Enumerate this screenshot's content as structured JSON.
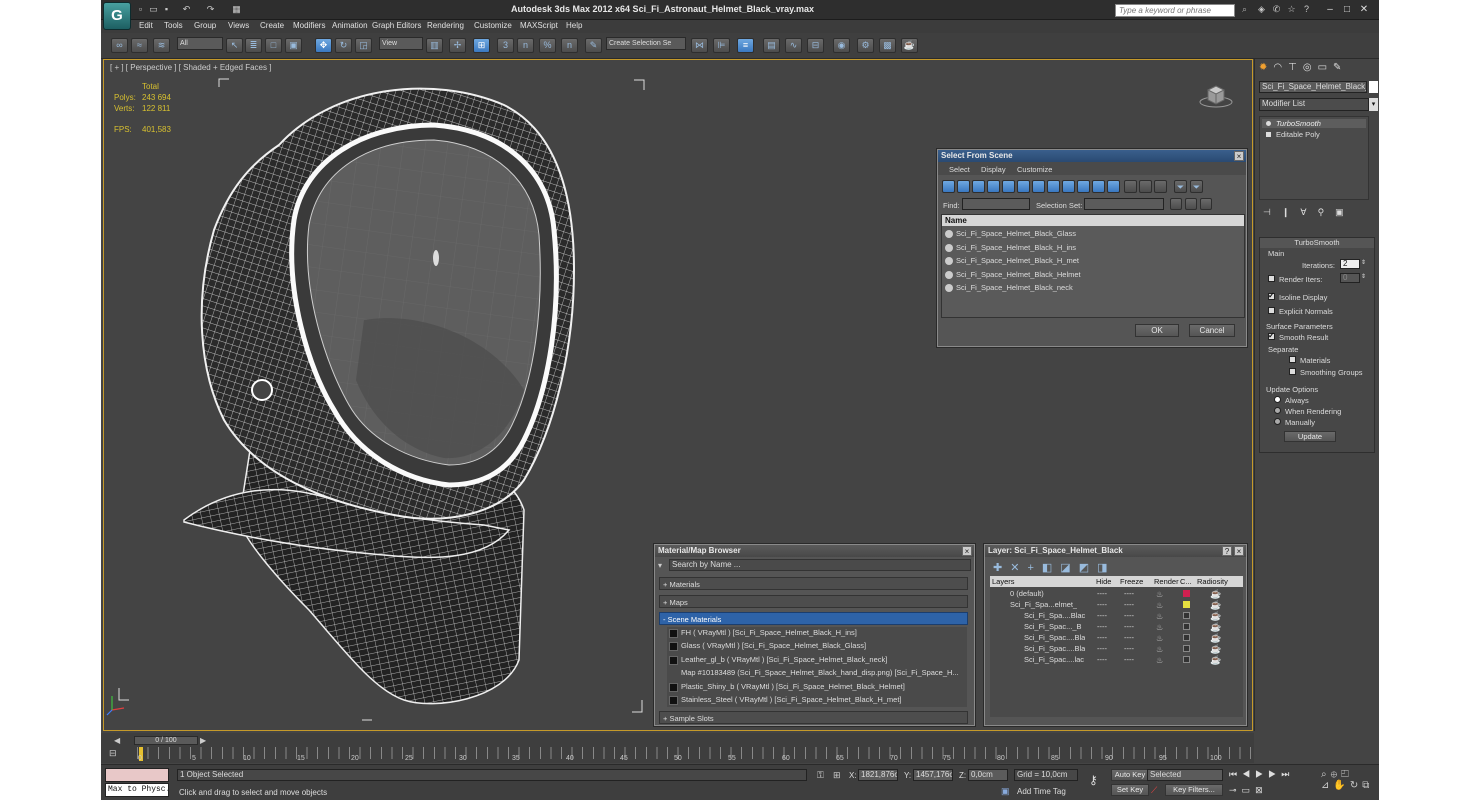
{
  "titlebar": {
    "title": "Autodesk 3ds Max  2012 x64     Sci_Fi_Astronaut_Helmet_Black_vray.max",
    "search_placeholder": "Type a keyword or phrase",
    "logo": "G"
  },
  "menu": [
    "Edit",
    "Tools",
    "Group",
    "Views",
    "Create",
    "Modifiers",
    "Animation",
    "Graph Editors",
    "Rendering",
    "Customize",
    "MAXScript",
    "Help"
  ],
  "toolbar": {
    "filter_dropdown": "All",
    "view_dropdown": "View",
    "selection_set_dropdown": "Create Selection Se",
    "snap_3": "3",
    "snap_angle": "n",
    "snap_percent": "%",
    "snap_spinner": "n"
  },
  "viewport": {
    "label": "[ + ] [ Perspective ] [ Shaded + Edged Faces ]",
    "stats": {
      "header": "Total",
      "polys_label": "Polys:",
      "polys": "243 694",
      "verts_label": "Verts:",
      "verts": "122 811",
      "fps_label": "FPS:",
      "fps": "401,583"
    },
    "accent_color": "#d7c030"
  },
  "select_from_scene": {
    "title": "Select From Scene",
    "menus": [
      "Select",
      "Display",
      "Customize"
    ],
    "find_label": "Find:",
    "selection_set_label": "Selection Set:",
    "column_name": "Name",
    "items": [
      "Sci_Fi_Space_Helmet_Black_Glass",
      "Sci_Fi_Space_Helmet_Black_H_ins",
      "Sci_Fi_Space_Helmet_Black_H_met",
      "Sci_Fi_Space_Helmet_Black_Helmet",
      "Sci_Fi_Space_Helmet_Black_neck"
    ],
    "ok": "OK",
    "cancel": "Cancel"
  },
  "material_browser": {
    "title": "Material/Map Browser",
    "search_placeholder": "Search by Name ...",
    "sections": [
      "+ Materials",
      "+ Maps",
      "- Scene Materials"
    ],
    "scene_materials": [
      "FH  ( VRayMtl ) [Sci_Fi_Space_Helmet_Black_H_ins]",
      "Glass  ( VRayMtl ) [Sci_Fi_Space_Helmet_Black_Glass]",
      "Leather_gl_b  ( VRayMtl ) [Sci_Fi_Space_Helmet_Black_neck]",
      "Map #10183489 (Sci_Fi_Space_Helmet_Black_hand_disp.png) [Sci_Fi_Space_H...",
      "Plastic_Shiny_b  ( VRayMtl ) [Sci_Fi_Space_Helmet_Black_Helmet]",
      "Stainless_Steel  ( VRayMtl ) [Sci_Fi_Space_Helmet_Black_H_met]"
    ],
    "sample_slots": "+ Sample Slots"
  },
  "layer_dialog": {
    "title": "Layer: Sci_Fi_Space_Helmet_Black",
    "help": "?",
    "columns": [
      "Layers",
      "Hide",
      "Freeze",
      "Render",
      "C...",
      "Radiosity"
    ],
    "rows": [
      "0 (default)",
      "Sci_Fi_Spa...elmet_",
      "Sci_Fi_Spa....Blac",
      "Sci_Fi_Spac..._B",
      "Sci_Fi_Spac....Bla",
      "Sci_Fi_Spac....Bla",
      "Sci_Fi_Spac....lac"
    ],
    "dash": "----"
  },
  "command_panel": {
    "object_name": "Sci_Fi_Space_Helmet_Black_h",
    "modifier_list": "Modifier List",
    "stack": [
      "TurboSmooth",
      "Editable Poly"
    ],
    "rollout_title": "TurboSmooth",
    "main_label": "Main",
    "iterations_label": "Iterations:",
    "iterations": "2",
    "render_iters_label": "Render Iters:",
    "render_iters": "0",
    "isoline": "Isoline Display",
    "explicit": "Explicit Normals",
    "surface_params": "Surface Parameters",
    "smooth_result": "Smooth Result",
    "separate": "Separate",
    "materials": "Materials",
    "smoothing_groups": "Smoothing Groups",
    "update_options": "Update Options",
    "always": "Always",
    "when_rendering": "When Rendering",
    "manually": "Manually",
    "update_btn": "Update"
  },
  "timeline": {
    "slider": "0 / 100",
    "ticks": [
      "0",
      "5",
      "10",
      "15",
      "20",
      "25",
      "30",
      "35",
      "40",
      "45",
      "50",
      "55",
      "60",
      "65",
      "70",
      "75",
      "80",
      "85",
      "90",
      "95",
      "100"
    ]
  },
  "status": {
    "maxscript_label": "Max to Physc.",
    "objects_selected": "1 Object Selected",
    "prompt": "Click and drag to select and move objects",
    "x_label": "X:",
    "x": "1821,876cı",
    "y_label": "Y:",
    "y": "1457,176cı",
    "z_label": "Z:",
    "z": "0,0cm",
    "grid": "Grid = 10,0cm",
    "add_time_tag": "Add Time Tag",
    "auto_key": "Auto Key",
    "selected": "Selected",
    "set_key": "Set Key",
    "key_filters": "Key Filters..."
  }
}
